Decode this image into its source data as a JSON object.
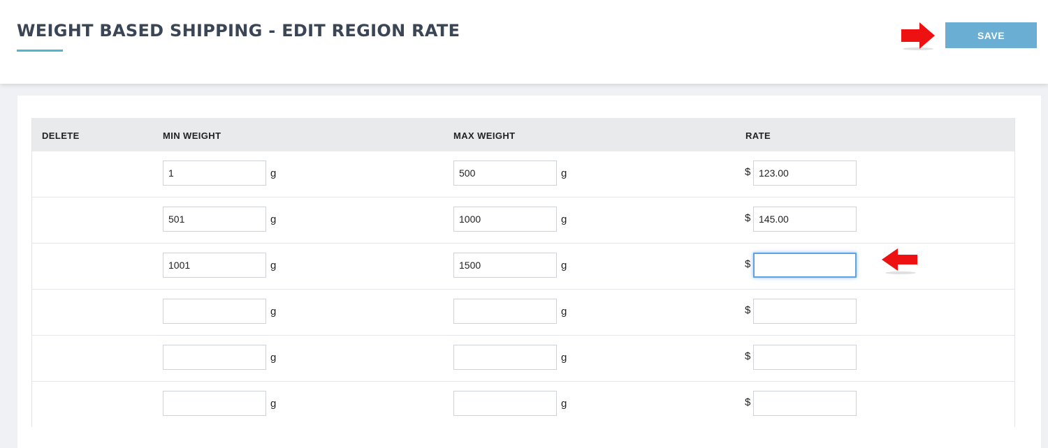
{
  "header": {
    "title": "WEIGHT BASED SHIPPING - EDIT REGION RATE",
    "save_label": "SAVE",
    "accent_color": "#4fb6cf",
    "save_color": "#6aaed3",
    "annotation_color": "#ee1111"
  },
  "table": {
    "columns": {
      "delete": "DELETE",
      "min": "MIN WEIGHT",
      "max": "MAX WEIGHT",
      "rate": "RATE"
    },
    "weight_unit": "g",
    "currency": "$",
    "rows": [
      {
        "min": "1",
        "max": "500",
        "rate": "123.00"
      },
      {
        "min": "501",
        "max": "1000",
        "rate": "145.00"
      },
      {
        "min": "1001",
        "max": "1500",
        "rate": ""
      },
      {
        "min": "",
        "max": "",
        "rate": ""
      },
      {
        "min": "",
        "max": "",
        "rate": ""
      },
      {
        "min": "",
        "max": "",
        "rate": ""
      }
    ]
  }
}
